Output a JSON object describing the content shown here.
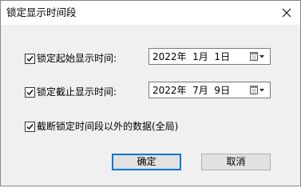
{
  "window": {
    "title": "锁定显示时间段"
  },
  "icons": {
    "close": "close-icon",
    "calendar": "calendar-dropdown-icon",
    "check": "checkmark-icon"
  },
  "start_time": {
    "label": "锁定起始显示时间:",
    "checked": true,
    "date": "2022年  1月  1日"
  },
  "end_time": {
    "label": "锁定截止显示时间:",
    "checked": true,
    "date": "2022年  7月  9日"
  },
  "global_option": {
    "label": "截断锁定时间段以外的数据(全局)",
    "checked": true
  },
  "buttons": {
    "ok": "确定",
    "cancel": "取消"
  },
  "colors": {
    "default_button_border": "#0078d7",
    "dialog_background": "#f0f0f0",
    "titlebar_background": "#ffffff"
  }
}
